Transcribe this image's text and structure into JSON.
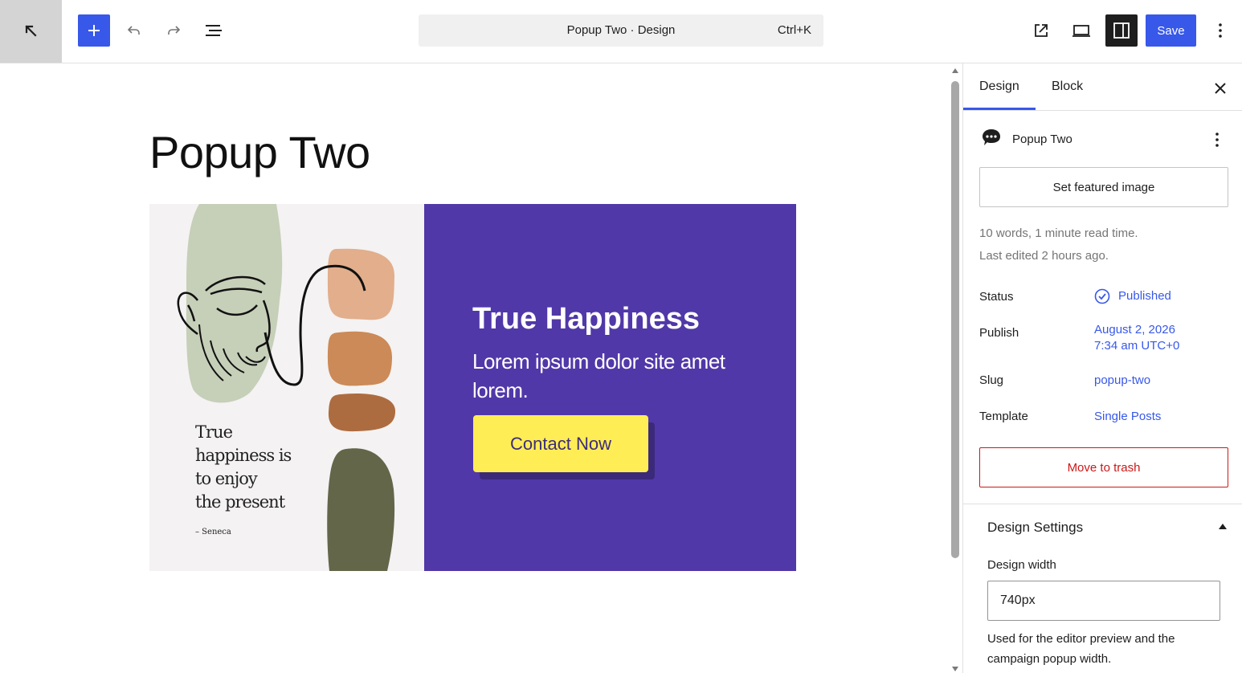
{
  "toolbar": {
    "command_title": "Popup Two · Design",
    "command_shortcut": "Ctrl+K",
    "save_label": "Save"
  },
  "canvas": {
    "page_title": "Popup Two",
    "popup": {
      "quote_lines": [
        "True",
        "happiness is",
        "to enjoy",
        "the present"
      ],
      "quote_author": "– Seneca",
      "heading": "True Happiness",
      "body": "Lorem ipsum dolor site amet lorem.",
      "cta_label": "Contact Now",
      "colors": {
        "left_bg": "#f4f2f2",
        "right_bg": "#5138a8",
        "cta_bg": "#ffed55",
        "cta_text": "#3d2c7c"
      }
    }
  },
  "sidebar": {
    "tabs": [
      {
        "label": "Design",
        "active": true
      },
      {
        "label": "Block",
        "active": false
      }
    ],
    "document_title": "Popup Two",
    "featured_image_label": "Set featured image",
    "word_count_text": "10 words, 1 minute read time.",
    "last_edited_text": "Last edited 2 hours ago.",
    "rows": {
      "status": {
        "label": "Status",
        "value": "Published"
      },
      "publish": {
        "label": "Publish",
        "value_line1": "August 2, 2026",
        "value_line2": "7:34 am UTC+0"
      },
      "slug": {
        "label": "Slug",
        "value": "popup-two"
      },
      "template": {
        "label": "Template",
        "value": "Single Posts"
      }
    },
    "trash_label": "Move to trash",
    "design_settings": {
      "title": "Design Settings",
      "width_label": "Design width",
      "width_value": "740px",
      "help_text": "Used for the editor preview and the campaign popup width."
    }
  },
  "colors": {
    "accent": "#3858e9",
    "danger": "#cc1818"
  }
}
